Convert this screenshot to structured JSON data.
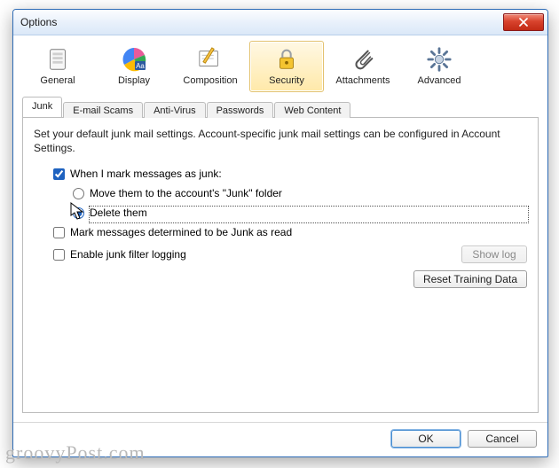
{
  "window": {
    "title": "Options"
  },
  "toolbar": [
    {
      "name": "general",
      "label": "General"
    },
    {
      "name": "display",
      "label": "Display"
    },
    {
      "name": "composition",
      "label": "Composition"
    },
    {
      "name": "security",
      "label": "Security",
      "selected": true
    },
    {
      "name": "attachments",
      "label": "Attachments"
    },
    {
      "name": "advanced",
      "label": "Advanced"
    }
  ],
  "tabs": [
    {
      "name": "junk",
      "label": "Junk",
      "active": true
    },
    {
      "name": "emailscams",
      "label": "E-mail Scams"
    },
    {
      "name": "antivirus",
      "label": "Anti-Virus"
    },
    {
      "name": "passwords",
      "label": "Passwords"
    },
    {
      "name": "webcontent",
      "label": "Web Content"
    }
  ],
  "junk": {
    "description": "Set your default junk mail settings. Account-specific junk mail settings can be configured in Account Settings.",
    "mark_checkbox": "When I mark messages as junk:",
    "radio_move": "Move them to the account's \"Junk\" folder",
    "radio_delete": "Delete them",
    "mark_as_read": "Mark messages determined to be Junk as read",
    "enable_logging": "Enable junk filter logging",
    "show_log": "Show log",
    "reset": "Reset Training Data"
  },
  "footer": {
    "ok": "OK",
    "cancel": "Cancel"
  },
  "watermark": "groovyPost.com"
}
